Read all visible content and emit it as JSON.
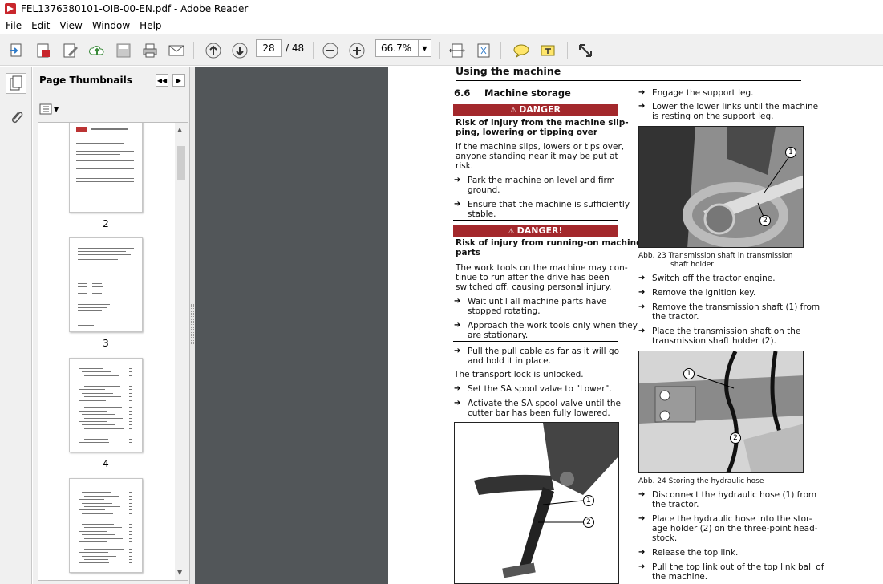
{
  "window": {
    "title": "FEL1376380101-OIB-00-EN.pdf - Adobe Reader"
  },
  "menu": [
    "File",
    "Edit",
    "View",
    "Window",
    "Help"
  ],
  "toolbar": {
    "page_current": "28",
    "page_total": "/ 48",
    "zoom": "66.7%"
  },
  "panel": {
    "title": "Page Thumbnails",
    "thumb_labels": [
      "2",
      "3",
      "4"
    ]
  },
  "doc": {
    "header": "Using the machine",
    "section_num": "6.6",
    "section_title": "Machine storage",
    "danger1": {
      "label": "DANGER",
      "title1": "Risk of injury from the machine slip-",
      "title2": "ping, lowering or tipping over",
      "body": [
        "If the machine slips, lowers or tips over,",
        "anyone standing near it may be put at",
        "risk."
      ]
    },
    "list1": [
      [
        "Park the machine on level and firm",
        "ground."
      ],
      [
        "Ensure that the machine is sufficiently",
        "stable."
      ]
    ],
    "danger2": {
      "label": "DANGER!",
      "title1": "Risk of injury from running-on machine",
      "title2": "parts",
      "body": [
        "The work tools on the machine may con-",
        "tinue to run after the drive has been",
        "switched off, causing personal injury."
      ]
    },
    "list2": [
      [
        "Wait until all machine parts have",
        "stopped rotating."
      ],
      [
        "Approach the work tools only when they",
        "are stationary."
      ]
    ],
    "list3": [
      [
        "Pull the pull cable as far as it will go",
        "and hold it in place."
      ]
    ],
    "transport_text": "The transport lock is unlocked.",
    "list4": [
      [
        "Set the SA spool valve to \"Lower\"."
      ],
      [
        "Activate the SA spool valve until the",
        "cutter bar has been fully lowered."
      ]
    ],
    "right_list1": [
      [
        "Engage the support leg."
      ],
      [
        "Lower the lower links until the machine",
        "is resting on the support leg."
      ]
    ],
    "fig23_caption1": "Abb. 23   Transmission shaft in transmission",
    "fig23_caption2": "shaft holder",
    "right_list2": [
      [
        "Switch off the tractor engine."
      ],
      [
        "Remove the ignition key."
      ],
      [
        "Remove the transmission shaft (1) from",
        "the tractor."
      ],
      [
        "Place the transmission shaft on the",
        "transmission shaft holder (2)."
      ]
    ],
    "fig24_caption": "Abb. 24   Storing the hydraulic hose",
    "right_list3": [
      [
        "Disconnect the hydraulic hose (1) from",
        "the tractor."
      ],
      [
        "Place the hydraulic hose into the stor-",
        "age holder (2) on the three-point head-",
        "stock."
      ],
      [
        "Release the top link."
      ],
      [
        "Pull the top link out of the top link ball of",
        "the machine."
      ]
    ],
    "callouts": [
      "1",
      "2"
    ]
  }
}
